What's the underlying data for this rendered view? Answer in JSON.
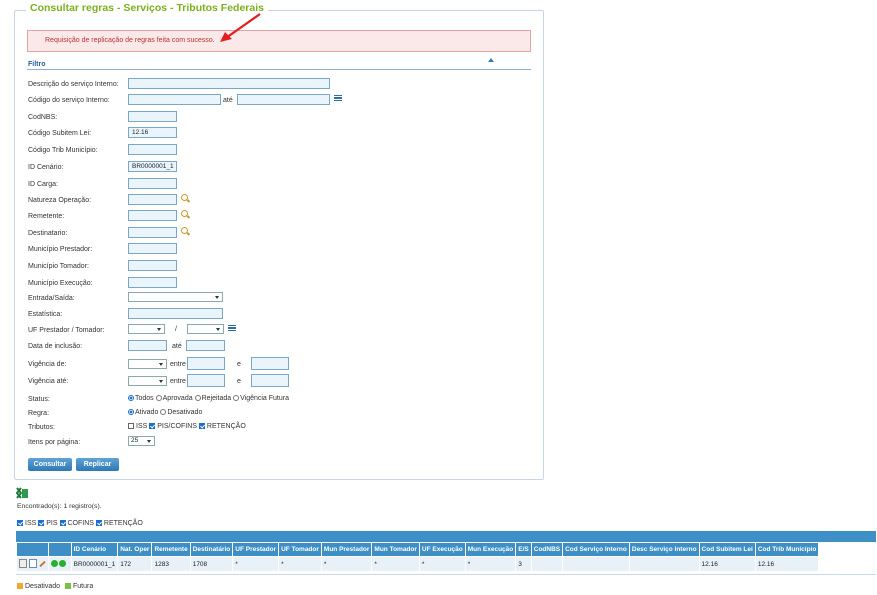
{
  "title": "Consultar regras - Serviços - Tributos Federais",
  "alert": "Requisição de replicação de regras feita com sucesso.",
  "filter": {
    "heading": "Filtro",
    "fields": {
      "descricao": {
        "label": "Descrição do serviço Interno:",
        "value": ""
      },
      "codigo_servico": {
        "label": "Código do serviço Interno:",
        "value": "",
        "ate_label": "até",
        "value2": ""
      },
      "codnbs": {
        "label": "CodNBS:",
        "value": ""
      },
      "subitem": {
        "label": "Código Subitem Lei:",
        "value": "12.16"
      },
      "trib_municipio": {
        "label": "Código Trib Município:",
        "value": ""
      },
      "cenario": {
        "label": "ID Cenário:",
        "value": "BR0000001_1"
      },
      "carga": {
        "label": "ID Carga:",
        "value": ""
      },
      "natureza": {
        "label": "Natureza Operação:",
        "value": ""
      },
      "remetente": {
        "label": "Remetente:",
        "value": ""
      },
      "destinatario": {
        "label": "Destinatario:",
        "value": ""
      },
      "mun_prestador": {
        "label": "Município Prestador:",
        "value": ""
      },
      "mun_tomador": {
        "label": "Município Tomador:",
        "value": ""
      },
      "mun_execucao": {
        "label": "Município Execução:",
        "value": ""
      },
      "entrada_saida": {
        "label": "Entrada/Saída:",
        "value": ""
      },
      "estatistica": {
        "label": "Estatística:",
        "value": ""
      },
      "uf": {
        "label": "UF Prestador / Tomador:",
        "sep": "/"
      },
      "data_inclusao": {
        "label": "Data de inclusão:",
        "ate_label": "até"
      },
      "vigencia_de": {
        "label": "Vigência de:",
        "entre_label": "entre",
        "e_label": "e"
      },
      "vigencia_ate": {
        "label": "Vigência até:",
        "entre_label": "entre",
        "e_label": "e"
      },
      "status": {
        "label": "Status:",
        "options": [
          "Todos",
          "Aprovada",
          "Rejeitada",
          "Vigência Futura"
        ],
        "selected": "Todos"
      },
      "regra": {
        "label": "Regra:",
        "options": [
          "Ativado",
          "Desativado"
        ],
        "selected": "Ativado"
      },
      "tributos": {
        "label": "Tributos:",
        "options": [
          "ISS",
          "PIS/COFINS",
          "RETENÇÃO"
        ],
        "checked": [
          "PIS/COFINS",
          "RETENÇÃO"
        ]
      },
      "itens": {
        "label": "Itens por página:",
        "value": "25"
      }
    },
    "consultar_label": "Consultar",
    "replicar_label": "Replicar"
  },
  "results": {
    "found_text": "Encontrado(s): 1 registro(s).",
    "toggles": [
      "ISS",
      "PIS",
      "COFINS",
      "RETENÇÃO"
    ],
    "columns": [
      "ID Cenário",
      "Nat. Oper",
      "Remetente",
      "Destinatário",
      "UF Prestador",
      "UF Tomador",
      "Mun Prestador",
      "Mun Tomador",
      "UF Execução",
      "Mun Execução",
      "E/S",
      "CodNBS",
      "Cod Serviço Interno",
      "Desc Serviço Interno",
      "Cod Subitem Lei",
      "Cod Trib Município"
    ],
    "rows": [
      [
        "BR0000001_1",
        "172",
        "1283",
        "1708",
        "*",
        "*",
        "*",
        "*",
        "*",
        "*",
        "3",
        "",
        "",
        "",
        "12.16",
        "12.16"
      ]
    ]
  },
  "legend": {
    "desativado": "Desativado",
    "futura": "Futura",
    "desativado_color": "#f0a830",
    "futura_color": "#7bc043"
  },
  "colors": {
    "title": "#7cb01f",
    "accent": "#3d8fc6",
    "alert_text": "#b33333"
  }
}
